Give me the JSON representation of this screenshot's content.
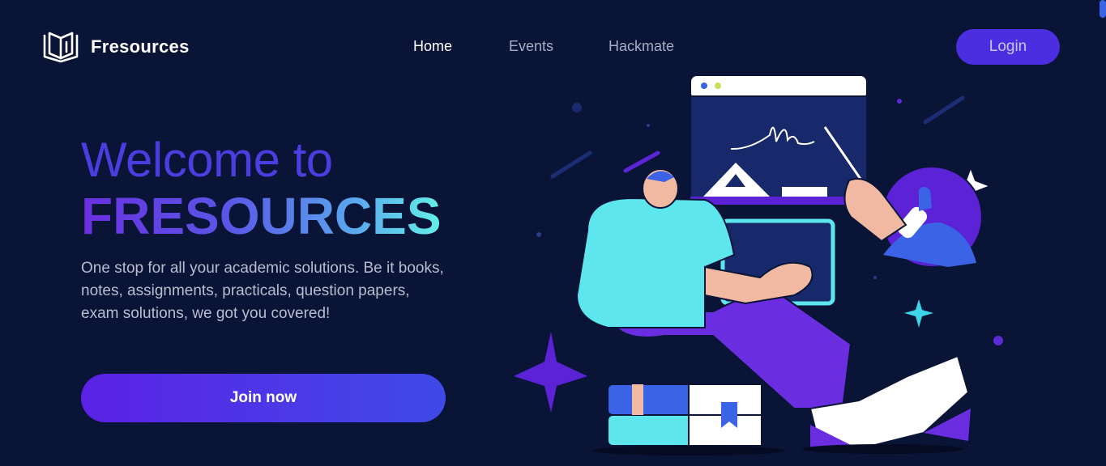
{
  "brand": {
    "name": "Fresources",
    "logo_icon": "book-logo-icon"
  },
  "nav": {
    "items": [
      {
        "label": "Home",
        "active": true
      },
      {
        "label": "Events",
        "active": false
      },
      {
        "label": "Hackmate",
        "active": false
      }
    ],
    "login_label": "Login"
  },
  "hero": {
    "welcome": "Welcome to",
    "title": "FRESOURCES",
    "description": "One stop for all your academic solutions. Be it books, notes, assignments, practicals, question papers, exam solutions, we got you covered!",
    "cta_label": "Join now"
  },
  "colors": {
    "background": "#0a1436",
    "accent": "#4a2ee0",
    "gradient_start": "#6a2fe0",
    "gradient_end": "#63f0e8"
  }
}
